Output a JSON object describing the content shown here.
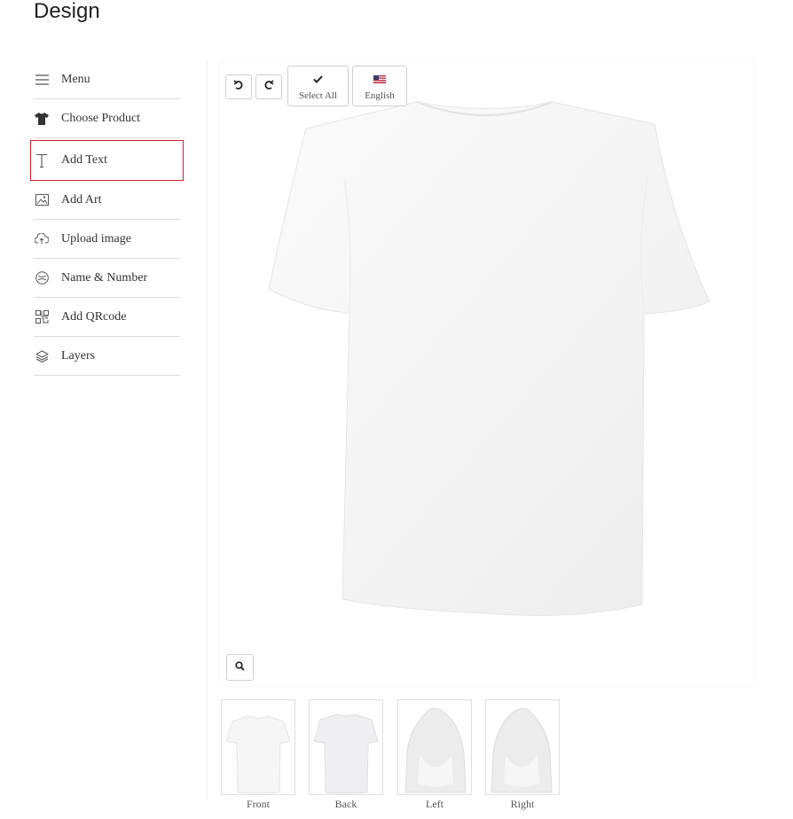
{
  "page": {
    "title": "Design"
  },
  "sidebar": {
    "items": [
      {
        "label": "Menu",
        "icon": "menu-icon"
      },
      {
        "label": "Choose Product",
        "icon": "tshirt-icon"
      },
      {
        "label": "Add Text",
        "icon": "text-icon",
        "active": true
      },
      {
        "label": "Add Art",
        "icon": "image-icon"
      },
      {
        "label": "Upload image",
        "icon": "cloud-upload-icon"
      },
      {
        "label": "Name & Number",
        "icon": "jersey-icon"
      },
      {
        "label": "Add QRcode",
        "icon": "qrcode-icon"
      },
      {
        "label": "Layers",
        "icon": "layers-icon"
      }
    ]
  },
  "toolbar": {
    "undo_icon": "undo-icon",
    "redo_icon": "redo-icon",
    "select_all_label": "Select All",
    "language_label": "English",
    "zoom_icon": "search-icon"
  },
  "views": [
    {
      "label": "Front"
    },
    {
      "label": "Back"
    },
    {
      "label": "Left"
    },
    {
      "label": "Right"
    }
  ],
  "colors": {
    "accent_border": "#d0202a",
    "shirt": "#f7f7f7"
  }
}
